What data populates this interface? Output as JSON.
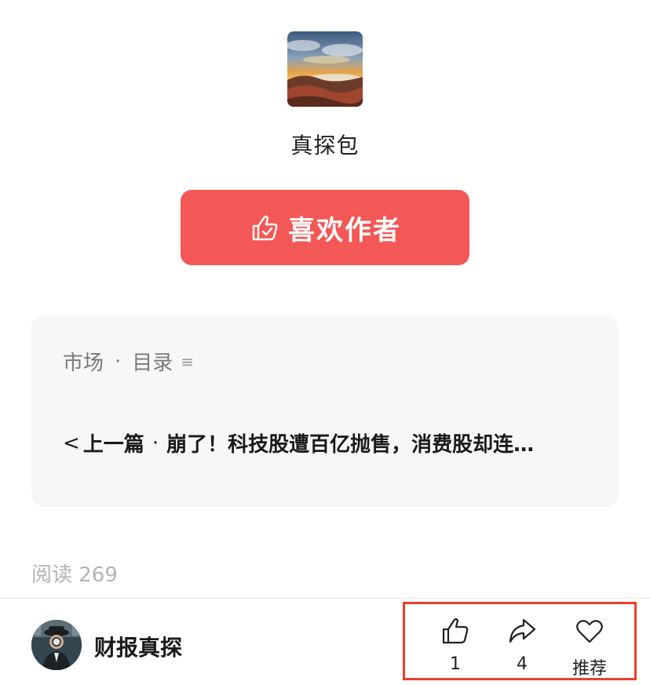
{
  "author": {
    "name": "真探包",
    "like_button_label": "喜欢作者"
  },
  "collection": {
    "category": "市场",
    "separator": "·",
    "catalog_label": "目录",
    "catalog_icon": "≡",
    "prev_chevron": "<",
    "prev_label": "上一篇",
    "prev_separator": "·",
    "prev_title": "崩了！科技股遭百亿抛售，消费股却连…"
  },
  "stats": {
    "read_label": "阅读 269"
  },
  "footer": {
    "account_name": "财报真探",
    "actions": [
      {
        "icon": "thumbs-up-icon",
        "label": "1"
      },
      {
        "icon": "share-icon",
        "label": "4"
      },
      {
        "icon": "heart-icon",
        "label": "推荐"
      }
    ]
  },
  "colors": {
    "button_red": "#f35857",
    "highlight_box": "#e8412c",
    "card_background": "#f7f7f7"
  }
}
